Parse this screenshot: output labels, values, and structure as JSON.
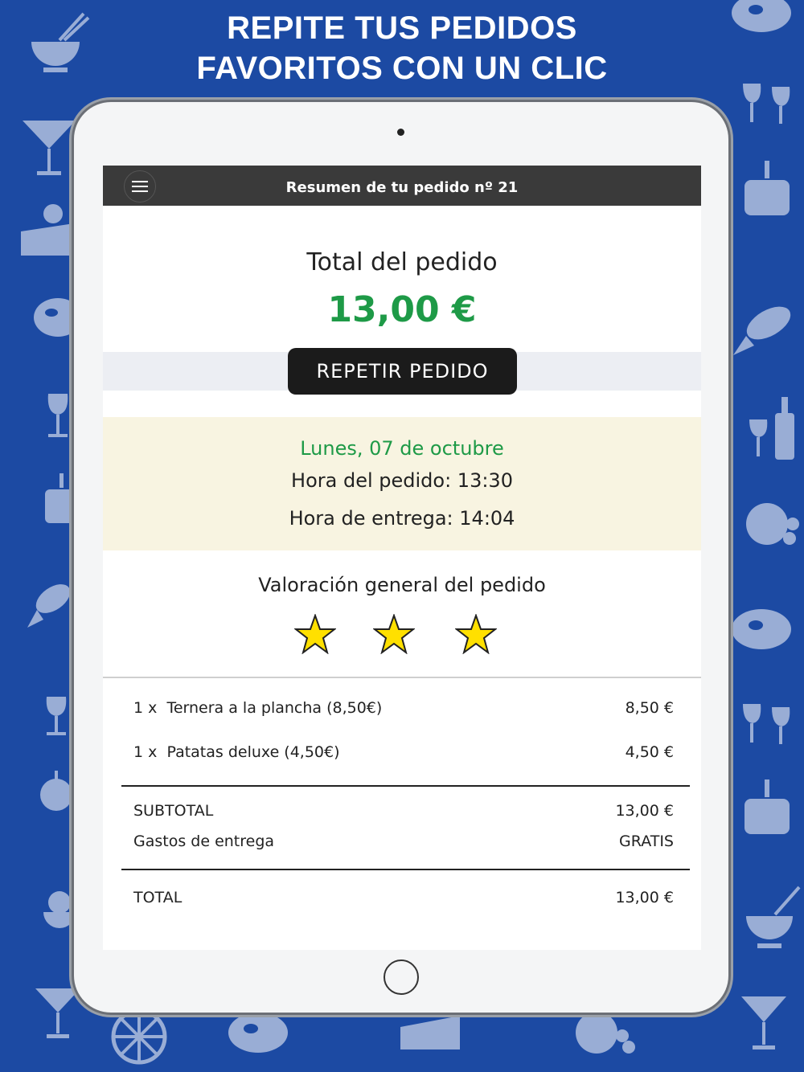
{
  "promo": {
    "line1": "REPITE TUS PEDIDOS",
    "line2": "FAVORITOS CON UN CLIC"
  },
  "background_icons": [
    "noodles-icon",
    "cocktail-icon",
    "cake-slice-icon",
    "steak-icon",
    "wine-glass-icon",
    "birthday-cake-icon",
    "fish-icon",
    "fruit-icon",
    "wine-bottle-icon",
    "toast-icon"
  ],
  "topbar": {
    "title": "Resumen de tu pedido nº 21",
    "menu_icon": "hamburger-menu-icon"
  },
  "summary": {
    "total_label": "Total del pedido",
    "total_amount": "13,00 €",
    "repeat_button": "REPETIR PEDIDO"
  },
  "info": {
    "date": "Lunes, 07 de octubre",
    "order_time": "Hora del pedido: 13:30",
    "delivery_time": "Hora de entrega: 14:04"
  },
  "rating": {
    "title": "Valoración general del pedido",
    "stars": 3,
    "max_stars": 3,
    "star_color": "#ffe000"
  },
  "items": [
    {
      "qty": "1 x",
      "name": "Ternera a la plancha (8,50€)",
      "price": "8,50 €"
    },
    {
      "qty": "1 x",
      "name": "Patatas deluxe (4,50€)",
      "price": "4,50 €"
    }
  ],
  "totals": {
    "subtotal_label": "SUBTOTAL",
    "subtotal_value": "13,00 €",
    "delivery_label": "Gastos de entrega",
    "delivery_value": "GRATIS",
    "total_label": "TOTAL",
    "total_value": "13,00 €"
  },
  "colors": {
    "background": "#1c4aa3",
    "accent_green": "#1e9a47",
    "topbar": "#3a3a3a",
    "button": "#1b1b1b",
    "info_box": "#f8f4e1"
  }
}
